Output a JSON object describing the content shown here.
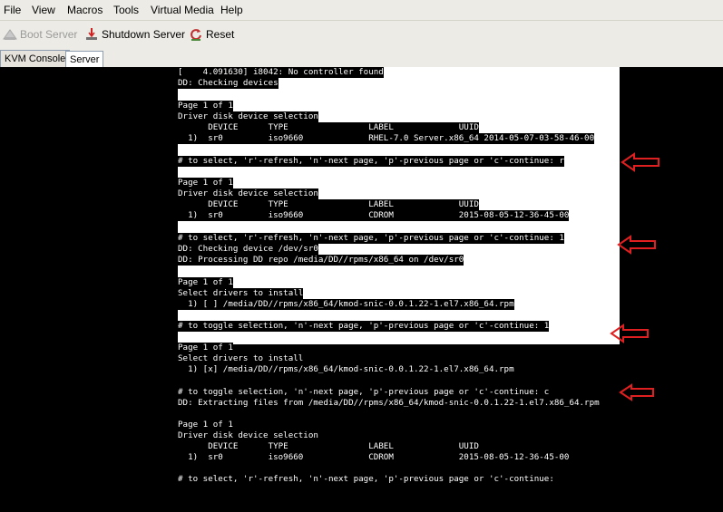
{
  "menu": [
    "File",
    "View",
    "Macros",
    "Tools",
    "Virtual Media",
    "Help"
  ],
  "toolbar": {
    "boot_label": "Boot Server",
    "shutdown_label": "Shutdown Server",
    "reset_label": "Reset"
  },
  "tabs": [
    "KVM Console",
    "Server"
  ],
  "terminal": {
    "lines": [
      "[    4.091630] i8042: No controller found",
      "DD: Checking devices",
      "",
      "Page 1 of 1",
      "Driver disk device selection",
      "      DEVICE      TYPE                LABEL             UUID",
      "  1)  sr0         iso9660             RHEL-7.0 Server.x86_64 2014-05-07-03-58-46-00",
      "",
      "# to select, 'r'-refresh, 'n'-next page, 'p'-previous page or 'c'-continue: r",
      "",
      "Page 1 of 1",
      "Driver disk device selection",
      "      DEVICE      TYPE                LABEL             UUID",
      "  1)  sr0         iso9660             CDROM             2015-08-05-12-36-45-00",
      "",
      "# to select, 'r'-refresh, 'n'-next page, 'p'-previous page or 'c'-continue: 1",
      "DD: Checking device /dev/sr0",
      "DD: Processing DD repo /media/DD//rpms/x86_64 on /dev/sr0",
      "",
      "Page 1 of 1",
      "Select drivers to install",
      "  1) [ ] /media/DD//rpms/x86_64/kmod-snic-0.0.1.22-1.el7.x86_64.rpm",
      "",
      "# to toggle selection, 'n'-next page, 'p'-previous page or 'c'-continue: 1",
      "",
      "Page 1 of 1",
      "Select drivers to install",
      "  1) [x] /media/DD//rpms/x86_64/kmod-snic-0.0.1.22-1.el7.x86_64.rpm",
      "",
      "# to toggle selection, 'n'-next page, 'p'-previous page or 'c'-continue: c",
      "DD: Extracting files from /media/DD//rpms/x86_64/kmod-snic-0.0.1.22-1.el7.x86_64.rpm",
      "",
      "Page 1 of 1",
      "Driver disk device selection",
      "      DEVICE      TYPE                LABEL             UUID",
      "  1)  sr0         iso9660             CDROM             2015-08-05-12-36-45-00",
      "",
      "# to select, 'r'-refresh, 'n'-next page, 'p'-previous page or 'c'-continue:"
    ]
  },
  "annotation": {
    "arrow_color": "#e02020"
  }
}
